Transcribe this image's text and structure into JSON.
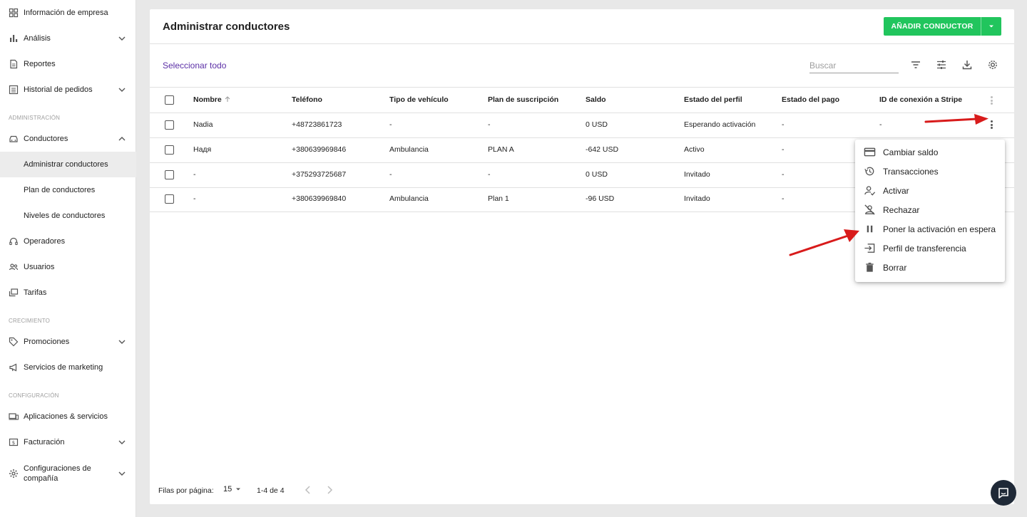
{
  "sidebar": {
    "items": [
      {
        "label": "Información de empresa",
        "icon": "dashboard-icon"
      },
      {
        "label": "Análisis",
        "icon": "bar-chart-icon"
      },
      {
        "label": "Reportes",
        "icon": "document-icon"
      },
      {
        "label": "Historial de pedidos",
        "icon": "list-icon"
      },
      {
        "label": "Conductores",
        "icon": "car-icon"
      },
      {
        "label": "Administrar conductores"
      },
      {
        "label": "Plan de conductores"
      },
      {
        "label": "Niveles de conductores"
      },
      {
        "label": "Operadores",
        "icon": "headset-icon"
      },
      {
        "label": "Usuarios",
        "icon": "users-icon"
      },
      {
        "label": "Tarifas",
        "icon": "tariffs-icon"
      },
      {
        "label": "Promociones",
        "icon": "tag-icon"
      },
      {
        "label": "Servicios de marketing",
        "icon": "megaphone-icon"
      },
      {
        "label": "Aplicaciones & servicios",
        "icon": "devices-icon"
      },
      {
        "label": "Facturación",
        "icon": "billing-icon"
      },
      {
        "label": "Configuraciones de compañía",
        "icon": "gear-icon"
      }
    ],
    "sections": {
      "admin": "ADMINISTRACIÓN",
      "growth": "CRECIMIENTO",
      "config": "CONFIGURACIÓN"
    }
  },
  "header": {
    "title": "Administrar conductores",
    "add_button": "AÑADIR CONDUCTOR"
  },
  "toolbar": {
    "select_all": "Seleccionar todo",
    "search_placeholder": "Buscar"
  },
  "table": {
    "columns": [
      "Nombre",
      "Teléfono",
      "Tipo de vehículo",
      "Plan de suscripción",
      "Saldo",
      "Estado del perfil",
      "Estado del pago",
      "ID de conexión a Stripe"
    ],
    "rows": [
      {
        "name": "Nadia",
        "phone": "+48723861723",
        "vehicle": "-",
        "plan": "-",
        "balance": "0 USD",
        "profile": "Esperando activación",
        "payment": "-",
        "stripe": "-"
      },
      {
        "name": "Надя",
        "phone": "+380639969846",
        "vehicle": "Ambulancia",
        "plan": "PLAN A",
        "balance": "-642 USD",
        "profile": "Activo",
        "payment": "-",
        "stripe": ""
      },
      {
        "name": "-",
        "phone": "+375293725687",
        "vehicle": "-",
        "plan": "-",
        "balance": "0 USD",
        "profile": "Invitado",
        "payment": "-",
        "stripe": ""
      },
      {
        "name": "-",
        "phone": "+380639969840",
        "vehicle": "Ambulancia",
        "plan": "Plan 1",
        "balance": "-96 USD",
        "profile": "Invitado",
        "payment": "-",
        "stripe": ""
      }
    ]
  },
  "menu": {
    "items": [
      {
        "label": "Cambiar saldo",
        "icon": "credit-card-icon"
      },
      {
        "label": "Transacciones",
        "icon": "history-icon"
      },
      {
        "label": "Activar",
        "icon": "user-check-icon"
      },
      {
        "label": "Rechazar",
        "icon": "user-off-icon"
      },
      {
        "label": "Poner la activación en espera",
        "icon": "pause-icon"
      },
      {
        "label": "Perfil de transferencia",
        "icon": "transfer-icon"
      },
      {
        "label": "Borrar",
        "icon": "trash-icon"
      }
    ]
  },
  "footer": {
    "rows_per_page_label": "Filas por página:",
    "rows_per_page": "15",
    "range": "1-4 de 4"
  },
  "colors": {
    "accent_green": "#21c55d",
    "link_purple": "#5b2fa6",
    "annotation_red": "#d81b1b"
  }
}
